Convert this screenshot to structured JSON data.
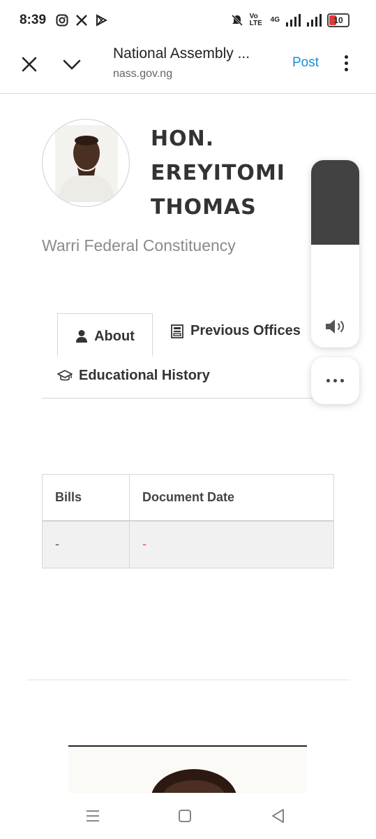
{
  "status_bar": {
    "time": "8:39",
    "left_icons": [
      "instagram-icon",
      "x-icon",
      "play-store-icon"
    ],
    "right_icons": [
      "mute-icon",
      "volte-icon",
      "4g-signal-icon",
      "signal-icon"
    ],
    "network_label": "4G",
    "volte_label": "Vo LTE",
    "battery_level": "10"
  },
  "browser": {
    "title": "National Assembly ...",
    "url": "nass.gov.ng",
    "post_label": "Post"
  },
  "profile": {
    "name": "HON. EREYITOMI THOMAS",
    "constituency": "Warri Federal Constituency"
  },
  "tabs": [
    {
      "label": "About",
      "icon": "user-icon",
      "active": true
    },
    {
      "label": "Previous Offices",
      "icon": "building-icon",
      "active": false
    },
    {
      "label": "Educational History",
      "icon": "graduation-cap-icon",
      "active": false
    }
  ],
  "bills_table": {
    "headers": [
      "Bills",
      "Document Date"
    ],
    "rows": [
      [
        "-",
        "-"
      ]
    ]
  },
  "volume": {
    "level": 0.45
  },
  "colors": {
    "link_blue": "#1a8cd8",
    "pink_dash": "#e83e8c",
    "volume_fill": "#424242",
    "battery_red": "#e53935"
  }
}
